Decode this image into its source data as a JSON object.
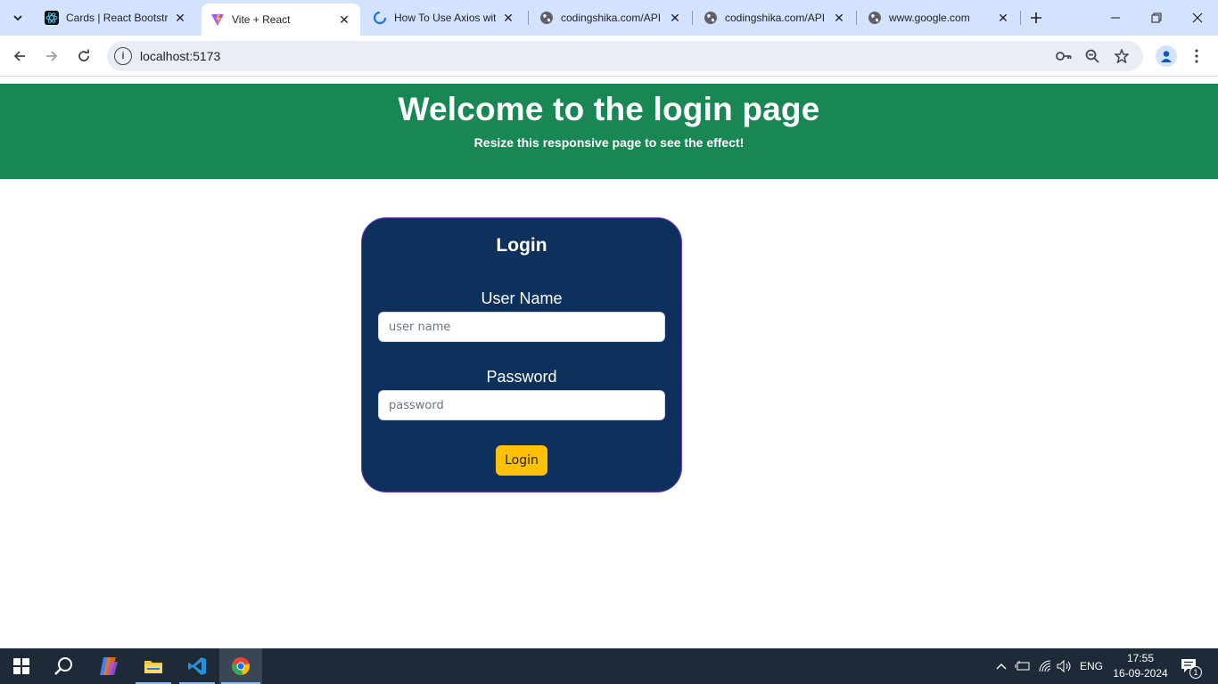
{
  "browser": {
    "tabs": [
      {
        "title": "Cards | React Bootstrap",
        "favicon": "react-bootstrap-icon",
        "active": false
      },
      {
        "title": "Vite + React",
        "favicon": "vite-icon",
        "active": true
      },
      {
        "title": "How To Use Axios with React",
        "favicon": "loading-icon",
        "active": false
      },
      {
        "title": "codingshika.com/API",
        "favicon": "globe-icon",
        "active": false
      },
      {
        "title": "codingshika.com/API",
        "favicon": "globe-icon",
        "active": false
      },
      {
        "title": "www.google.com",
        "favicon": "globe-icon",
        "active": false
      }
    ],
    "url": "localhost:5173"
  },
  "page": {
    "header_title": "Welcome to the login page",
    "header_subtitle": "Resize this responsive page to see the effect!",
    "card_title": "Login",
    "username_label": "User Name",
    "username_placeholder": "user name",
    "password_label": "Password",
    "password_placeholder": "password",
    "login_button": "Login"
  },
  "taskbar": {
    "language": "ENG",
    "time": "17:55",
    "date": "16-09-2024",
    "notification_count": "1"
  },
  "colors": {
    "header_bg": "#198754",
    "card_bg": "#0d315c",
    "card_border": "#6f42c1",
    "button_bg": "#ffc107",
    "tabbar_bg": "#d3e3fd"
  }
}
